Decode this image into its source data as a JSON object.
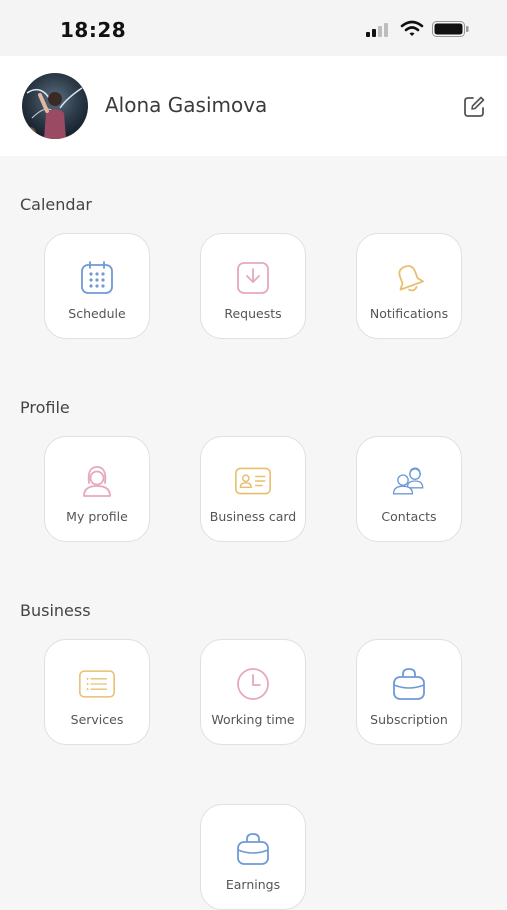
{
  "status_bar": {
    "time": "18:28"
  },
  "profile": {
    "name": "Alona Gasimova"
  },
  "sections": {
    "calendar": {
      "title": "Calendar",
      "items": [
        {
          "label": "Schedule",
          "icon": "calendar-icon",
          "color": "#6f9ad6"
        },
        {
          "label": "Requests",
          "icon": "download-icon",
          "color": "#e6a8bd"
        },
        {
          "label": "Notifications",
          "icon": "bell-icon",
          "color": "#e8bf6e"
        }
      ]
    },
    "profile": {
      "title": "Profile",
      "items": [
        {
          "label": "My profile",
          "icon": "user-icon",
          "color": "#e6a8bd"
        },
        {
          "label": "Business card",
          "icon": "id-card-icon",
          "color": "#e8bf6e"
        },
        {
          "label": "Contacts",
          "icon": "contacts-icon",
          "color": "#6f9ad6"
        }
      ]
    },
    "business": {
      "title": "Business",
      "items": [
        {
          "label": "Services",
          "icon": "list-icon",
          "color": "#e8bf6e"
        },
        {
          "label": "Working time",
          "icon": "clock-icon",
          "color": "#e6a8bd"
        },
        {
          "label": "Subscription",
          "icon": "bag-icon",
          "color": "#6f9ad6"
        },
        {
          "label": "Earnings",
          "icon": "bag-icon",
          "color": "#6f9ad6"
        }
      ]
    }
  }
}
